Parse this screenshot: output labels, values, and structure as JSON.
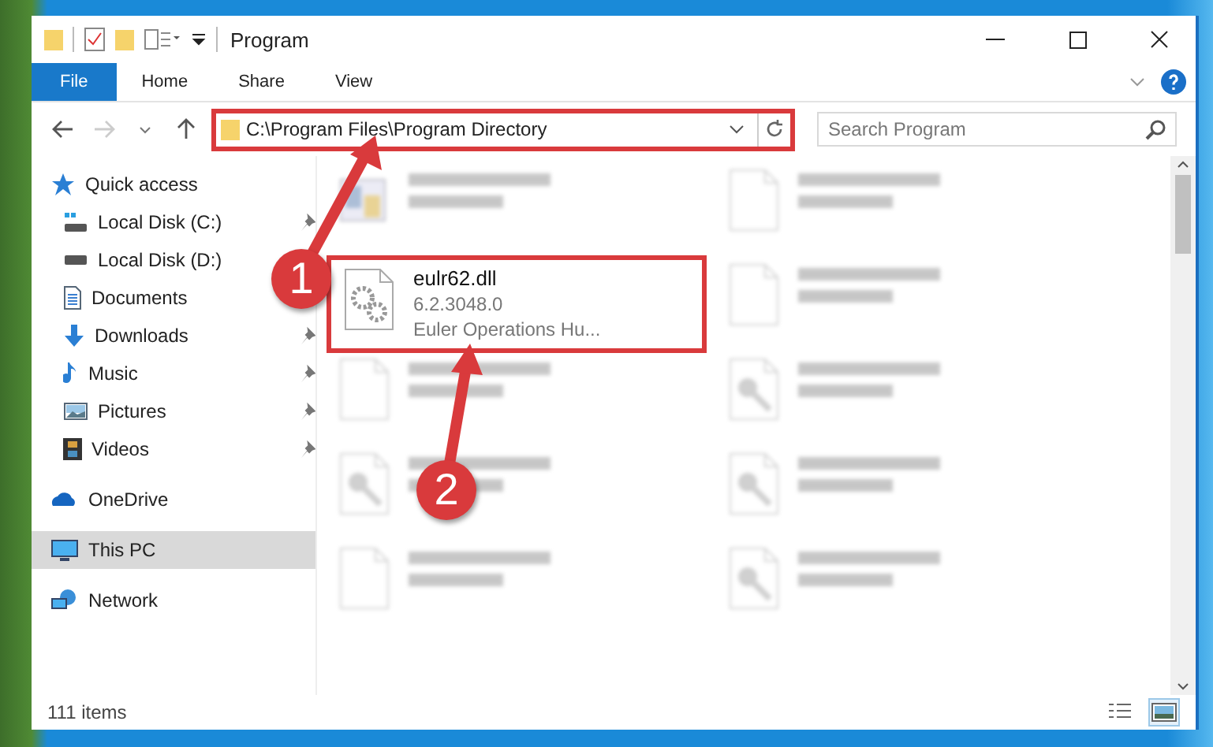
{
  "window": {
    "title": "Program"
  },
  "ribbon": {
    "tabs": [
      {
        "label": "File",
        "selected": true
      },
      {
        "label": "Home",
        "selected": false
      },
      {
        "label": "Share",
        "selected": false
      },
      {
        "label": "View",
        "selected": false
      }
    ]
  },
  "address": {
    "path": "C:\\Program Files\\Program Directory",
    "highlighted": true
  },
  "search": {
    "placeholder": "Search Program"
  },
  "nav": [
    {
      "label": "Quick access",
      "children": [
        {
          "label": "Local Disk (C:)",
          "pinned": true
        },
        {
          "label": "Local Disk (D:)",
          "pinned": false
        },
        {
          "label": "Documents",
          "pinned": false
        },
        {
          "label": "Downloads",
          "pinned": true
        },
        {
          "label": "Music",
          "pinned": true
        },
        {
          "label": "Pictures",
          "pinned": true
        },
        {
          "label": "Videos",
          "pinned": true
        }
      ],
      "selected": false
    },
    {
      "label": "OneDrive",
      "selected": false
    },
    {
      "label": "This PC",
      "selected": true
    },
    {
      "label": "Network",
      "selected": false
    }
  ],
  "files": [
    {
      "kind": "exe",
      "blurred": true,
      "highlighted": false
    },
    {
      "kind": "blank",
      "blurred": true,
      "highlighted": false
    },
    {
      "kind": "settings",
      "name": "eulr62.dll",
      "lines": [
        "6.2.3048.0",
        "Euler Operations Hu..."
      ],
      "blurred": false,
      "highlighted": true
    },
    {
      "kind": "blank",
      "blurred": true,
      "highlighted": false
    },
    {
      "kind": "blank",
      "blurred": true,
      "highlighted": false
    },
    {
      "kind": "resource",
      "blurred": true,
      "highlighted": false
    },
    {
      "kind": "resource",
      "blurred": true,
      "highlighted": false
    },
    {
      "kind": "resource",
      "blurred": true,
      "highlighted": false
    },
    {
      "kind": "blank",
      "blurred": true,
      "highlighted": false
    },
    {
      "kind": "resource",
      "blurred": true,
      "highlighted": false
    }
  ],
  "status_bar": {
    "count": "111 items",
    "views": [
      {
        "selected": false
      },
      {
        "selected": true
      }
    ]
  },
  "annotations": [
    {
      "number": "1"
    },
    {
      "number": "2"
    }
  ]
}
